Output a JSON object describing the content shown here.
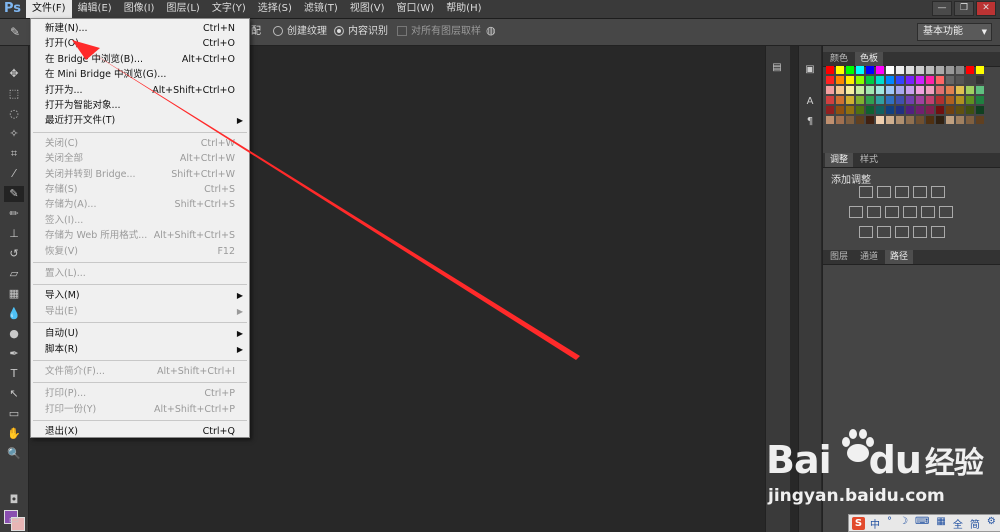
{
  "app": {
    "logo": "Ps",
    "workspace": "基本功能"
  },
  "menubar": {
    "items": [
      "文件(F)",
      "编辑(E)",
      "图像(I)",
      "图层(L)",
      "文字(Y)",
      "选择(S)",
      "滤镜(T)",
      "视图(V)",
      "窗口(W)",
      "帮助(H)"
    ],
    "active_index": 0
  },
  "window_controls": {
    "minimize": "—",
    "restore": "❐",
    "close": "✕"
  },
  "options_bar": {
    "partial_label": "配",
    "radio_create_texture": "创建纹理",
    "radio_content_aware": "内容识别",
    "checkbox_sample_all": "对所有图层取样"
  },
  "file_menu": {
    "items": [
      {
        "label": "新建(N)...",
        "shortcut": "Ctrl+N",
        "enabled": true
      },
      {
        "label": "打开(O)...",
        "shortcut": "Ctrl+O",
        "enabled": true
      },
      {
        "label": "在 Bridge 中浏览(B)...",
        "shortcut": "Alt+Ctrl+O",
        "enabled": true
      },
      {
        "label": "在 Mini Bridge 中浏览(G)...",
        "shortcut": "",
        "enabled": true
      },
      {
        "label": "打开为...",
        "shortcut": "Alt+Shift+Ctrl+O",
        "enabled": true
      },
      {
        "label": "打开为智能对象...",
        "shortcut": "",
        "enabled": true
      },
      {
        "label": "最近打开文件(T)",
        "shortcut": "",
        "enabled": true,
        "submenu": true
      },
      {
        "separator": true
      },
      {
        "label": "关闭(C)",
        "shortcut": "Ctrl+W",
        "enabled": false
      },
      {
        "label": "关闭全部",
        "shortcut": "Alt+Ctrl+W",
        "enabled": false
      },
      {
        "label": "关闭并转到 Bridge...",
        "shortcut": "Shift+Ctrl+W",
        "enabled": false
      },
      {
        "label": "存储(S)",
        "shortcut": "Ctrl+S",
        "enabled": false
      },
      {
        "label": "存储为(A)...",
        "shortcut": "Shift+Ctrl+S",
        "enabled": false
      },
      {
        "label": "签入(I)...",
        "shortcut": "",
        "enabled": false
      },
      {
        "label": "存储为 Web 所用格式...",
        "shortcut": "Alt+Shift+Ctrl+S",
        "enabled": false
      },
      {
        "label": "恢复(V)",
        "shortcut": "F12",
        "enabled": false
      },
      {
        "separator": true
      },
      {
        "label": "置入(L)...",
        "shortcut": "",
        "enabled": false
      },
      {
        "separator": true
      },
      {
        "label": "导入(M)",
        "shortcut": "",
        "enabled": true,
        "submenu": true
      },
      {
        "label": "导出(E)",
        "shortcut": "",
        "enabled": false,
        "submenu": true
      },
      {
        "separator": true
      },
      {
        "label": "自动(U)",
        "shortcut": "",
        "enabled": true,
        "submenu": true
      },
      {
        "label": "脚本(R)",
        "shortcut": "",
        "enabled": true,
        "submenu": true
      },
      {
        "separator": true
      },
      {
        "label": "文件简介(F)...",
        "shortcut": "Alt+Shift+Ctrl+I",
        "enabled": false
      },
      {
        "separator": true
      },
      {
        "label": "打印(P)...",
        "shortcut": "Ctrl+P",
        "enabled": false
      },
      {
        "label": "打印一份(Y)",
        "shortcut": "Alt+Shift+Ctrl+P",
        "enabled": false
      },
      {
        "separator": true
      },
      {
        "label": "退出(X)",
        "shortcut": "Ctrl+Q",
        "enabled": true
      }
    ]
  },
  "panels": {
    "color_tabs": [
      "颜色",
      "色板"
    ],
    "adjust_tabs": [
      "调整",
      "样式"
    ],
    "adjust_title": "添加调整",
    "layer_tabs": [
      "图层",
      "通道",
      "路径"
    ]
  },
  "dock_icons": {
    "type_icon": "A",
    "para_icon": "¶"
  },
  "watermark": {
    "brand": "Bai",
    "brand2": "du",
    "cn": "经验",
    "url": "jingyan.baidu.com"
  },
  "ime": {
    "s": "S",
    "items": [
      "中",
      "°",
      "☽",
      "⌨",
      "▦",
      "全",
      "简",
      "⚙"
    ]
  },
  "colors": {
    "accent_arrow": "#ff2a2a",
    "fg": "#8a4fb0",
    "bg": "#e8b5b5"
  }
}
